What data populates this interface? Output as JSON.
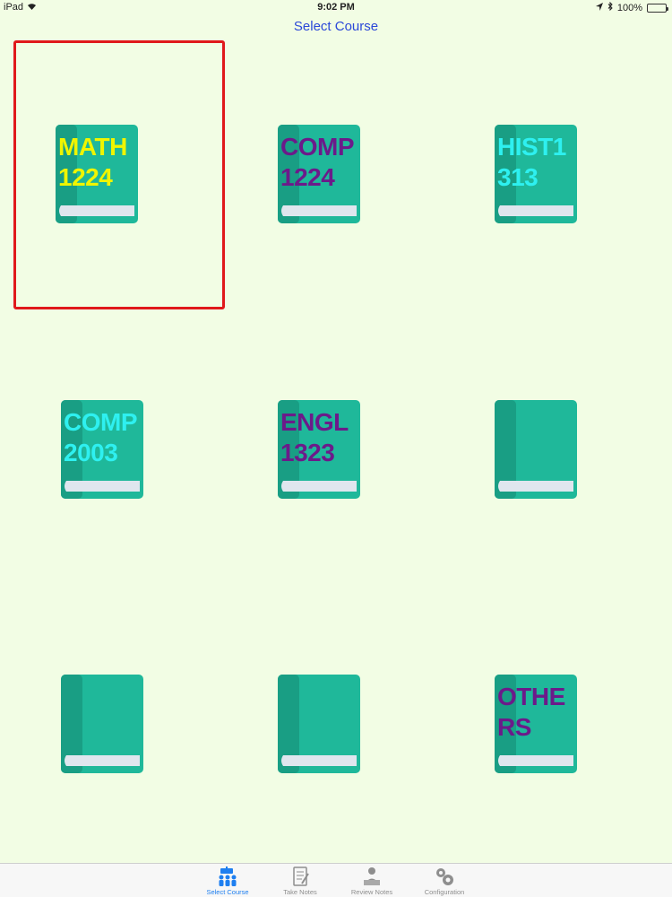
{
  "status_bar": {
    "device": "iPad",
    "time": "9:02 PM",
    "battery": "100%",
    "battery_level": 1.0
  },
  "nav": {
    "title": "Select Course"
  },
  "courses": [
    {
      "label": "MATH\n1224",
      "color": "#f0f500",
      "selected": true
    },
    {
      "label": "COMP\n1224",
      "color": "#6c1a8a",
      "selected": false
    },
    {
      "label": "HIST1\n313",
      "color": "#2ef0f0",
      "selected": false
    },
    {
      "label": "COMP\n2003",
      "color": "#2ef0f0",
      "selected": false
    },
    {
      "label": "ENGL\n1323",
      "color": "#6c1a8a",
      "selected": false
    },
    {
      "label": "",
      "color": "#6c1a8a",
      "selected": false
    },
    {
      "label": "",
      "color": "#6c1a8a",
      "selected": false
    },
    {
      "label": "",
      "color": "#6c1a8a",
      "selected": false
    },
    {
      "label": "OTHE\nRS",
      "color": "#6c1a8a",
      "selected": false
    }
  ],
  "colors": {
    "book_cover": "#1fb89a",
    "book_spine": "#199e84",
    "book_pages": "#dfe6ee",
    "selection_border": "#e0191b",
    "tab_active": "#1e7ff0",
    "tab_inactive": "#8e8e8e",
    "background": "#f2fde4"
  },
  "tab_bar": {
    "tabs": [
      {
        "label": "Select Course",
        "icon": "people-icon",
        "active": true
      },
      {
        "label": "Take Notes",
        "icon": "notepad-icon",
        "active": false
      },
      {
        "label": "Review Notes",
        "icon": "reader-icon",
        "active": false
      },
      {
        "label": "Configuration",
        "icon": "gears-icon",
        "active": false
      }
    ]
  }
}
